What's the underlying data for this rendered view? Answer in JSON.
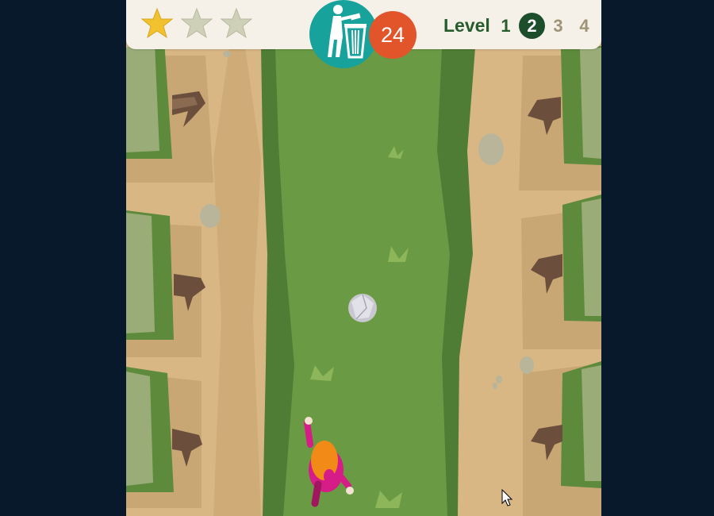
{
  "hud": {
    "stars": [
      {
        "name": "star-earned",
        "earned": true,
        "color": "#f2c22e"
      },
      {
        "name": "star-empty",
        "earned": false,
        "color": "#cfd0b8"
      },
      {
        "name": "star-empty",
        "earned": false,
        "color": "#cfd0b8"
      }
    ],
    "bin_icon": "trash-bin-icon",
    "trash_remaining": "24",
    "level": {
      "label": "Level",
      "items": [
        {
          "label": "1",
          "state": "done"
        },
        {
          "label": "2",
          "state": "current"
        },
        {
          "label": "3",
          "state": "locked"
        },
        {
          "label": "4",
          "state": "locked"
        }
      ]
    }
  },
  "scene": {
    "colors": {
      "path": "#d9b785",
      "grass": "#6a9a44",
      "grass_edge": "#4f7d35",
      "hedge": "#9aac78",
      "hedge_dark": "#5d8a3b",
      "stump": "#6b4f3c",
      "player_shirt": "#d61c86",
      "player_hair": "#f28a17"
    },
    "objects": [
      "trash-ball",
      "rock",
      "tree-stump",
      "hedge",
      "player-character"
    ]
  }
}
